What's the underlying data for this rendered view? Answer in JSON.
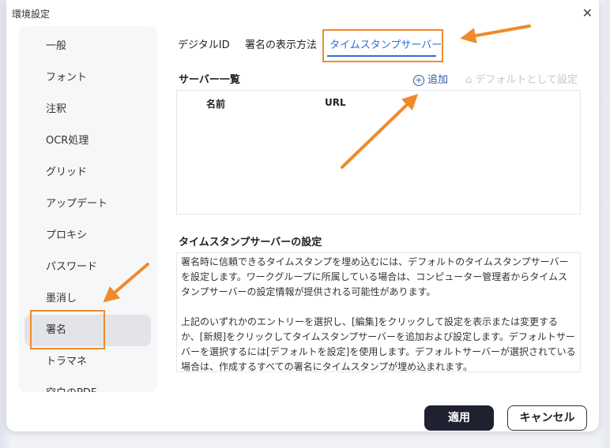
{
  "dialog": {
    "title": "環境設定",
    "close_icon": "close-icon"
  },
  "sidebar": {
    "items": [
      "一般",
      "フォント",
      "注釈",
      "OCR処理",
      "グリッド",
      "アップデート",
      "プロキシ",
      "パスワード",
      "墨消し",
      "署名",
      "トラマネ",
      "空白のPDF"
    ],
    "active": "署名"
  },
  "tabs": [
    "デジタルID",
    "署名の表示方法",
    "タイムスタンプサーバー"
  ],
  "active_tab": "タイムスタンプサーバー",
  "server_list": {
    "heading": "サーバー一覧",
    "add_label": "追加",
    "set_default_label": "デフォルトとして設定",
    "columns": [
      "名前",
      "URL"
    ],
    "rows": []
  },
  "settings": {
    "heading": "タイムスタンプサーバーの設定",
    "paragraphs": [
      "署名時に信頼できるタイムスタンプを埋め込むには、デフォルトのタイムスタンプサーバーを設定します。ワークグループに所属している場合は、コンピューター管理者からタイムスタンプサーバーの設定情報が提供される可能性があります。",
      "上記のいずれかのエントリーを選択し、[編集]をクリックして設定を表示または変更するか、[新規]をクリックしてタイムスタンプサーバーを追加および設定します。デフォルトサーバーを選択するには[デフォルトを設定]を使用します。デフォルトサーバーが選択されている場合は、作成するすべての署名にタイムスタンプが埋め込まれます。"
    ]
  },
  "footer": {
    "apply": "適用",
    "cancel": "キャンセル"
  },
  "colors": {
    "accent": "#2e6fd6",
    "annotation": "#f08a2c",
    "primary_button": "#1f2130"
  }
}
